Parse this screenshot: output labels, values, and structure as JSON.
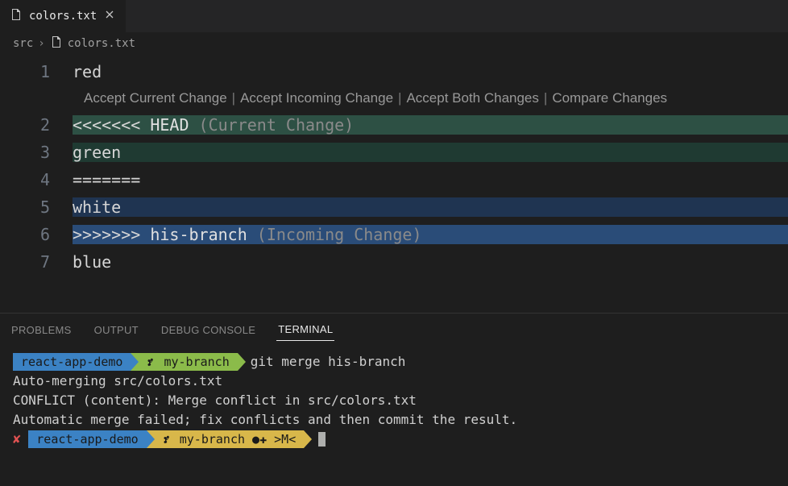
{
  "tab": {
    "filename": "colors.txt"
  },
  "breadcrumb": {
    "folder": "src",
    "filename": "colors.txt"
  },
  "codelens": {
    "accept_current": "Accept Current Change",
    "accept_incoming": "Accept Incoming Change",
    "accept_both": "Accept Both Changes",
    "compare": "Compare Changes"
  },
  "editor": {
    "lines": {
      "1": {
        "num": "1",
        "text": "red"
      },
      "2": {
        "num": "2",
        "marker": "<<<<<<< ",
        "head": "HEAD",
        "annotation": " (Current Change)"
      },
      "3": {
        "num": "3",
        "text": "green"
      },
      "4": {
        "num": "4",
        "text": "======="
      },
      "5": {
        "num": "5",
        "text": "white"
      },
      "6": {
        "num": "6",
        "marker": ">>>>>>> ",
        "branch": "his-branch",
        "annotation": " (Incoming Change)"
      },
      "7": {
        "num": "7",
        "text": "blue"
      }
    }
  },
  "panelTabs": {
    "problems": "PROBLEMS",
    "output": "OUTPUT",
    "debug": "DEBUG CONSOLE",
    "terminal": "TERMINAL"
  },
  "terminal": {
    "prompt1": {
      "project": "react-app-demo",
      "branch": "my-branch",
      "command": "git merge his-branch"
    },
    "out1": "Auto-merging src/colors.txt",
    "out2": "CONFLICT (content): Merge conflict in src/colors.txt",
    "out3": "Automatic merge failed; fix conflicts and then commit the result.",
    "prompt2": {
      "x": "✘",
      "project": "react-app-demo",
      "branch": "my-branch ●✚ >M<"
    }
  }
}
